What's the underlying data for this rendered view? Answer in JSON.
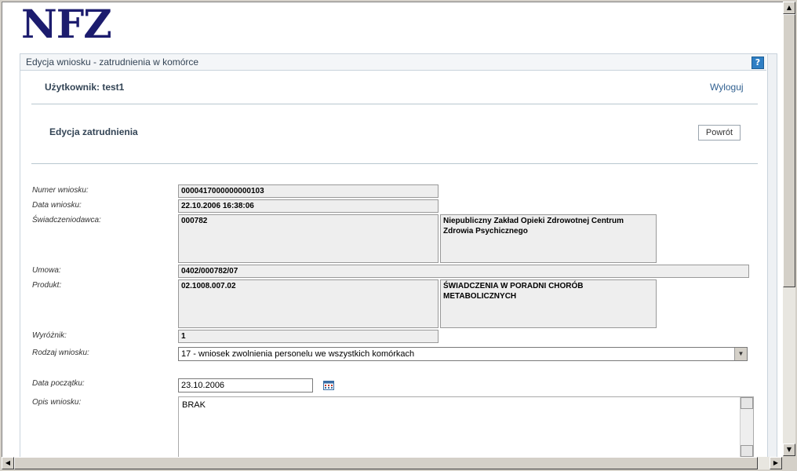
{
  "logo": {
    "text": "NFZ"
  },
  "panel": {
    "title": "Edycja wniosku - zatrudnienia w komórce",
    "help_label": "?"
  },
  "user": {
    "label": "Użytkownik: test1",
    "logout": "Wyloguj"
  },
  "section": {
    "title": "Edycja zatrudnienia",
    "back_button": "Powrót"
  },
  "form": {
    "numer_wniosku": {
      "label": "Numer wniosku:",
      "value": "0000417000000000103"
    },
    "data_wniosku": {
      "label": "Data wniosku:",
      "value": "22.10.2006 16:38:06"
    },
    "swiadczeniodawca": {
      "label": "Świadczeniodawca:",
      "code": "000782",
      "name": "Niepubliczny Zakład Opieki Zdrowotnej Centrum Zdrowia Psychicznego"
    },
    "umowa": {
      "label": "Umowa:",
      "value": "0402/000782/07"
    },
    "produkt": {
      "label": "Produkt:",
      "code": "02.1008.007.02",
      "name": "ŚWIADCZENIA W PORADNI CHORÓB METABOLICZNYCH"
    },
    "wyroznik": {
      "label": "Wyróżnik:",
      "value": "1"
    },
    "rodzaj_wniosku": {
      "label": "Rodzaj wniosku:",
      "selected": "17 - wniosek zwolnienia personelu we wszystkich komórkach"
    },
    "data_poczatku": {
      "label": "Data początku:",
      "value": "23.10.2006"
    },
    "opis_wniosku": {
      "label": "Opis wniosku:",
      "value": "BRAK"
    }
  },
  "colors": {
    "accent": "#2f7fc4",
    "logo": "#1c1c6e",
    "link": "#2f5f8f"
  }
}
